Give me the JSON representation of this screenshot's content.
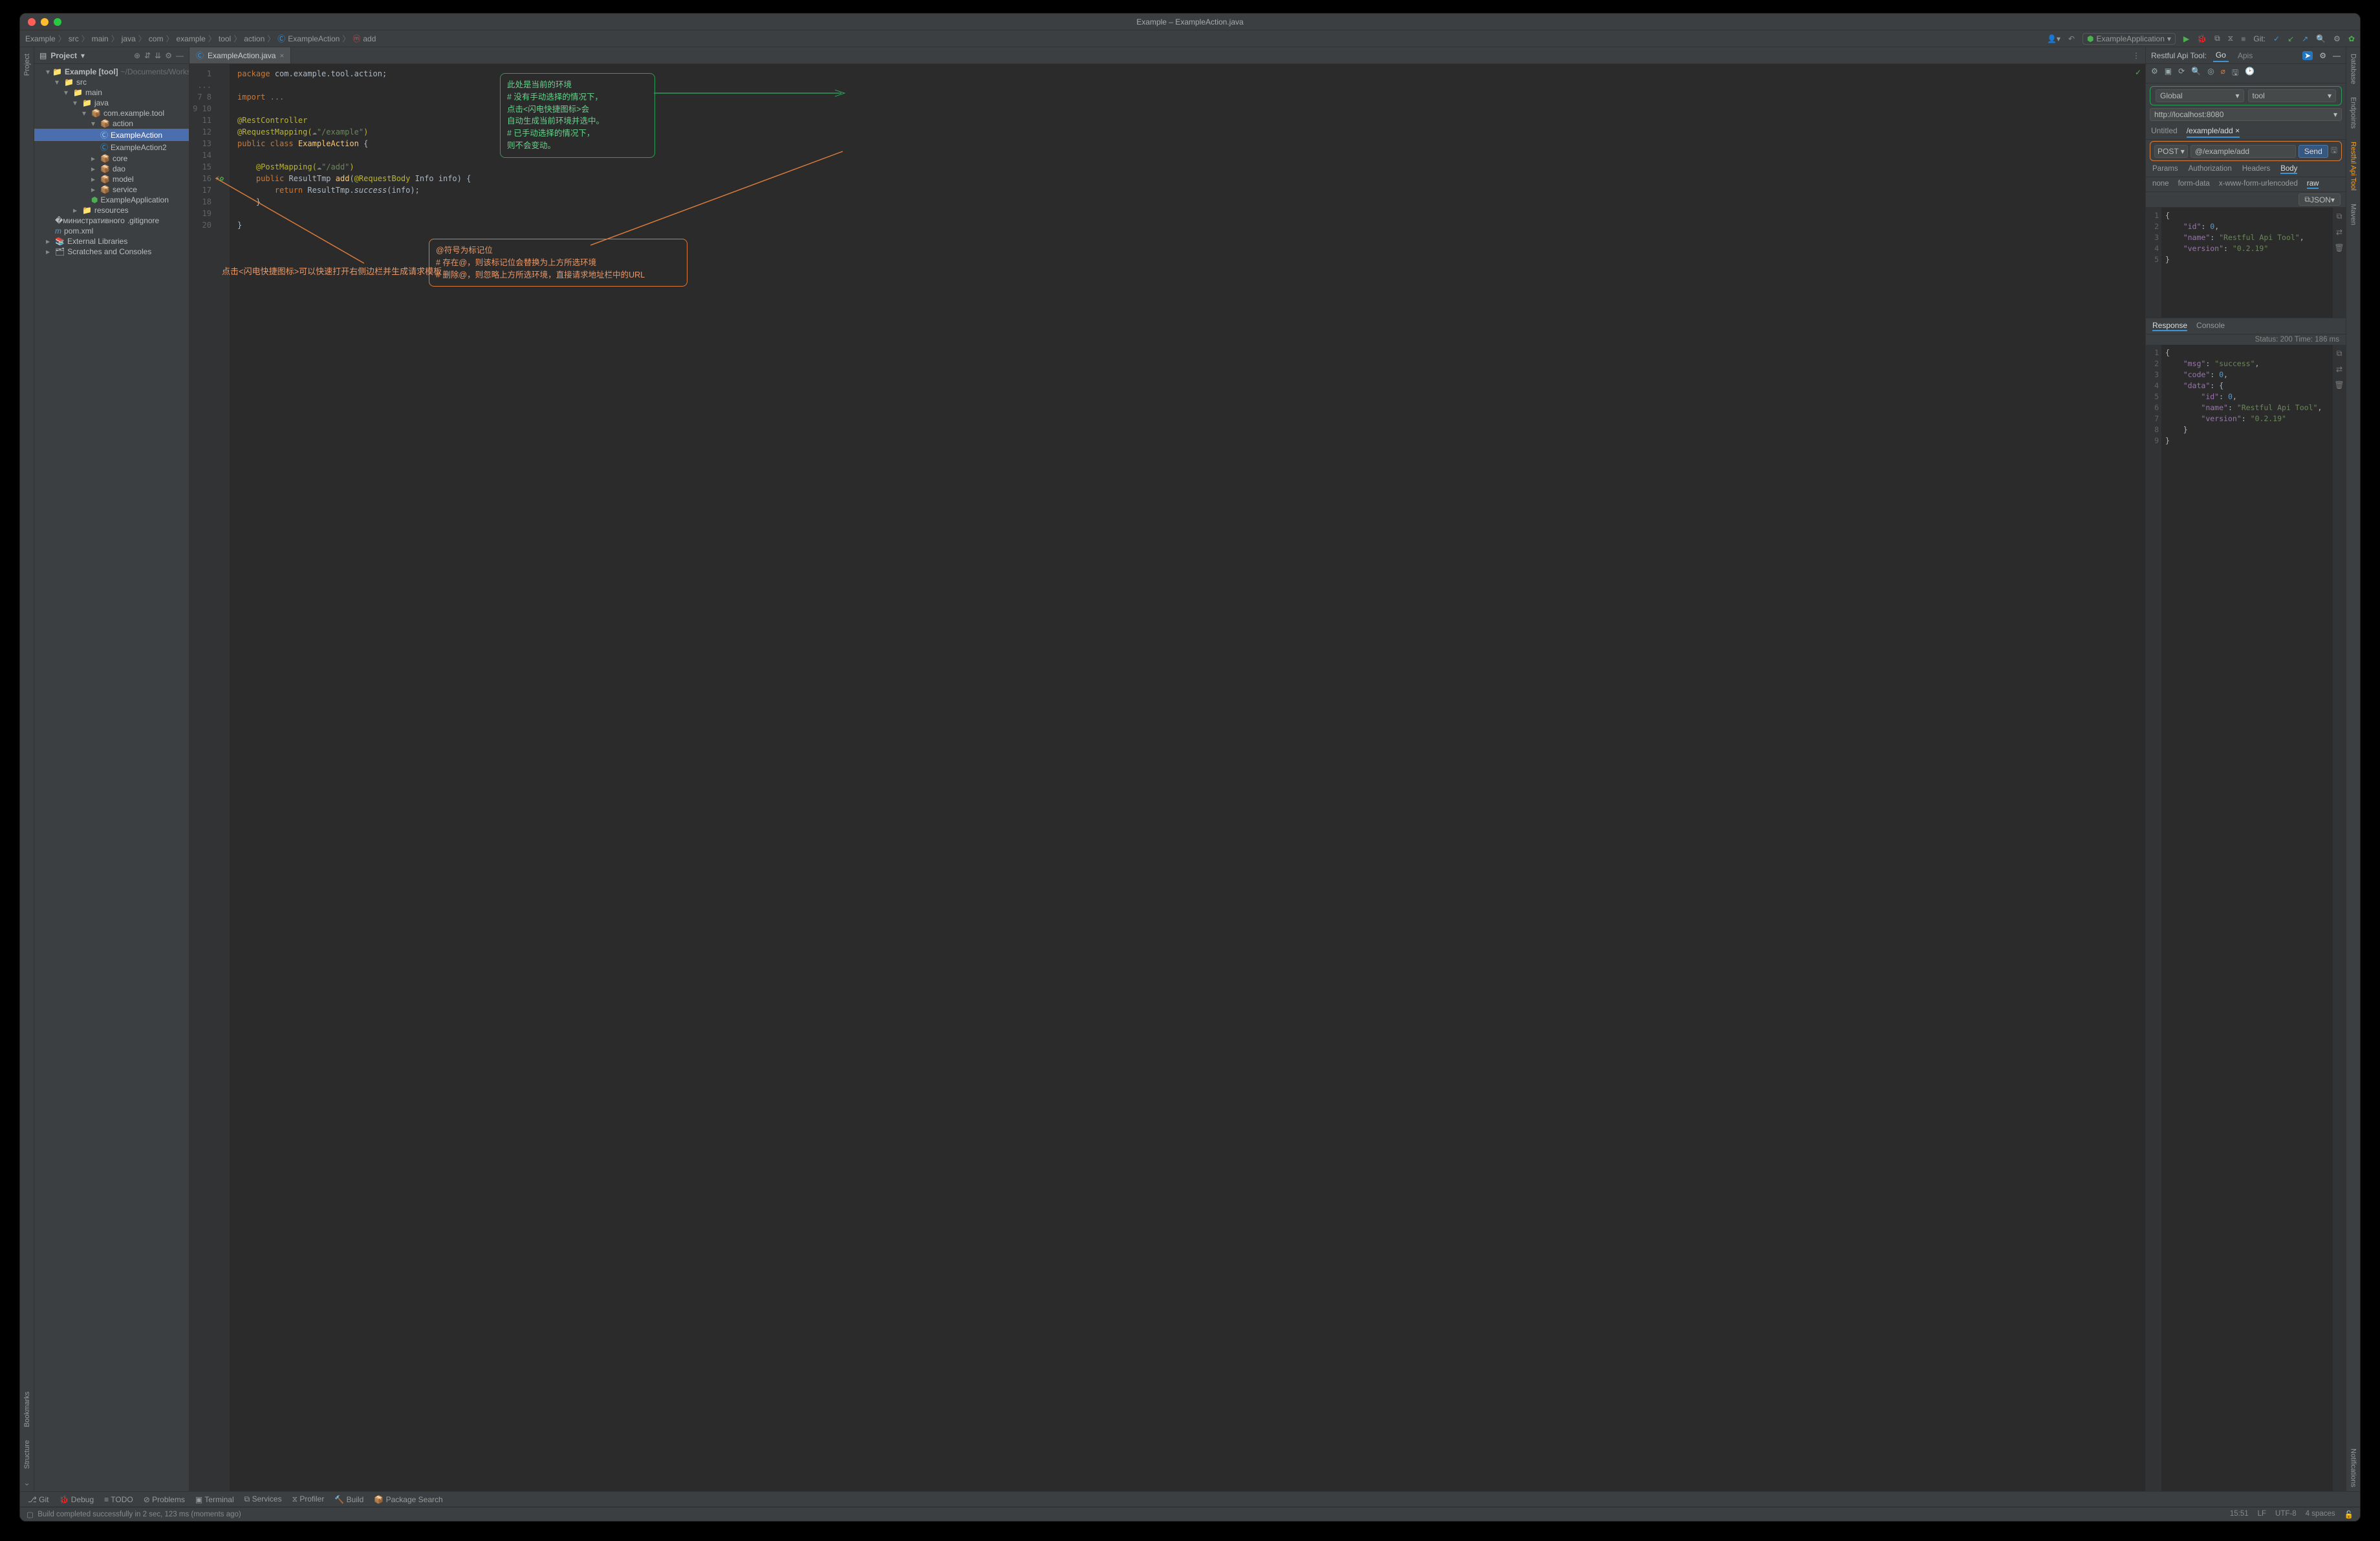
{
  "window": {
    "title": "Example – ExampleAction.java"
  },
  "breadcrumbs": [
    "Example",
    "src",
    "main",
    "java",
    "com",
    "example",
    "tool",
    "action",
    "ExampleAction",
    "add"
  ],
  "toolbar": {
    "run_config": "ExampleApplication",
    "git_label": "Git:"
  },
  "project": {
    "title": "Project",
    "root": "Example [tool]",
    "root_path": "~/Documents/Workspace/ij_",
    "nodes": {
      "src": "src",
      "main": "main",
      "java": "java",
      "pkg": "com.example.tool",
      "action": "action",
      "example_action": "ExampleAction",
      "example_action2": "ExampleAction2",
      "core": "core",
      "dao": "dao",
      "model": "model",
      "service": "service",
      "app": "ExampleApplication",
      "resources": "resources",
      "gitignore": ".gitignore",
      "pom": "pom.xml",
      "ext": "External Libraries",
      "scratch": "Scratches and Consoles"
    }
  },
  "leftstrip": {
    "project": "Project",
    "bookmarks": "Bookmarks",
    "structure": "Structure"
  },
  "rightstrip": {
    "database": "Database",
    "endpoints": "Endpoints",
    "restful": "Restful Api Tool",
    "maven": "Maven",
    "notifications": "Notifications"
  },
  "editor": {
    "tab": "ExampleAction.java",
    "lines": [
      "1",
      "...",
      "7",
      "8",
      "9",
      "10",
      "11",
      "12",
      "13",
      "14",
      "15",
      "16",
      "17",
      "18",
      "19",
      "20"
    ],
    "code": {
      "l1": "package com.example.tool.action;",
      "l7": "import ...",
      "l9": "@RestController",
      "l10a": "@RequestMapping(",
      "l10b": "\"/example\"",
      "l10c": ")",
      "l11a": "public class ",
      "l11b": "ExampleAction ",
      "l11c": "{",
      "l14a": "    @PostMapping(",
      "l14b": "\"/add\"",
      "l14c": ")",
      "l15a": "    public ",
      "l15b": "ResultTmp ",
      "l15c": "add",
      "l15d": "(@RequestBody ",
      "l15e": "Info ",
      "l15f": "info) {",
      "l16a": "        return ",
      "l16b": "ResultTmp",
      "l16c": ".success(",
      "l16d": "info",
      "l16e": ");",
      "l17": "    }",
      "l19": "}"
    }
  },
  "annot": {
    "green": "此处是当前的环境\n# 没有手动选择的情况下，\n点击<闪电快捷图标>会\n自动生成当前环境并选中。\n# 已手动选择的情况下，\n则不会变动。",
    "orange": "@符号为标记位\n# 存在@，则该标记位会替换为上方所选环境\n# 删除@，则忽略上方所选环境，直接请求地址栏中的URL",
    "orange_left": "点击<闪电快捷图标>可以快速打开右侧边栏并生成请求模板"
  },
  "rest": {
    "title": "Restful Api Tool:",
    "tabs": {
      "go": "Go",
      "apis": "Apis"
    },
    "env": {
      "global": "Global",
      "tool": "tool",
      "url": "http://localhost:8080"
    },
    "req_tabs": {
      "untitled": "Untitled",
      "path": "/example/add"
    },
    "method": "POST",
    "url": "@/example/add",
    "send": "Send",
    "param_tabs": {
      "params": "Params",
      "auth": "Authorization",
      "headers": "Headers",
      "body": "Body"
    },
    "body_tabs": {
      "none": "none",
      "form": "form-data",
      "xwww": "x-www-form-urlencoded",
      "raw": "raw"
    },
    "format": "JSON",
    "request_body_lines": [
      "1",
      "2",
      "3",
      "4",
      "5"
    ],
    "request_body": "{\n    \"id\": 0,\n    \"name\": \"Restful Api Tool\",\n    \"version\": \"0.2.19\"\n}",
    "resp_tabs": {
      "response": "Response",
      "console": "Console"
    },
    "status": "Status: 200  Time: 186 ms",
    "response_lines": [
      "1",
      "2",
      "3",
      "4",
      "5",
      "6",
      "7",
      "8",
      "9"
    ],
    "response_body": "{\n    \"msg\": \"success\",\n    \"code\": 0,\n    \"data\": {\n        \"id\": 0,\n        \"name\": \"Restful Api Tool\",\n        \"version\": \"0.2.19\"\n    }\n}"
  },
  "bottombar": {
    "git": "Git",
    "debug": "Debug",
    "todo": "TODO",
    "problems": "Problems",
    "terminal": "Terminal",
    "services": "Services",
    "profiler": "Profiler",
    "build": "Build",
    "pkg": "Package Search"
  },
  "status": {
    "msg": "Build completed successfully in 2 sec, 123 ms (moments ago)",
    "time": "15:51",
    "lf": "LF",
    "enc": "UTF-8",
    "indent": "4 spaces"
  }
}
